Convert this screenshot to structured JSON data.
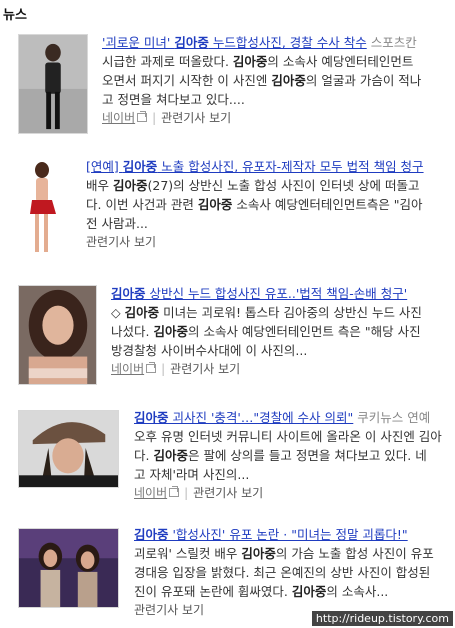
{
  "section": {
    "title": "뉴스"
  },
  "articles": [
    {
      "title_parts": [
        "'괴로운 미녀' ",
        "김아중",
        " 누드합성사진, 경찰 수사 착수"
      ],
      "source": "스포츠칸",
      "desc_lines": [
        [
          "시급한 과제로 떠올랐다. ",
          "김아중",
          "의 소속사 예당엔터테인먼트"
        ],
        [
          "오면서 퍼지기 시작한 이 사진엔 ",
          "김아중",
          "의 얼굴과 가슴이 적나"
        ],
        [
          "고 정면을 쳐다보고 있다....",
          "",
          ""
        ]
      ],
      "naver": "네이버",
      "related": "관련기사 보기"
    },
    {
      "title_parts": [
        "[연예] ",
        "김아중",
        " 노출 합성사진, 유포자-제작자 모두 법적 책임 청구"
      ],
      "source": "",
      "desc_lines": [
        [
          "배우 ",
          "김아중",
          "(27)의 상반신 노출 합성 사진이 인터넷 상에 떠돌고"
        ],
        [
          "다. 이번 사건과 관련 ",
          "김아중",
          " 소속사 예당엔터테인먼트측은 \"김아"
        ],
        [
          "전 사람과...",
          "",
          ""
        ]
      ],
      "naver": "",
      "related": "관련기사 보기"
    },
    {
      "title_parts": [
        "",
        "김아중",
        " 상반신 누드 합성사진 유포..'법적 책임-손배 청구'"
      ],
      "source": "",
      "desc_lines": [
        [
          "◇ ",
          "김아중",
          " 미녀는 괴로워! 톱스타 김아중의 상반신 누드 사진"
        ],
        [
          "나섰다. ",
          "김아중",
          "의 소속사 예당엔터테인먼트 측은 \"해당 사진"
        ],
        [
          "방경찰청 사이버수사대에 이 사진의...",
          "",
          ""
        ]
      ],
      "naver": "네이버",
      "related": "관련기사 보기"
    },
    {
      "title_parts": [
        "",
        "김아중",
        " 괴사진 '충격'…\"경찰에 수사 의뢰\""
      ],
      "source": "쿠키뉴스 연예",
      "desc_lines": [
        [
          "오후 유명 인터넷 커뮤니티 사이트에 올라온 이 사진엔 김아",
          "",
          ""
        ],
        [
          "다. ",
          "김아중",
          "은 팔에 상의를 들고 정면을 쳐다보고 있다. 네"
        ],
        [
          "고 자체'라며 사진의...",
          "",
          ""
        ]
      ],
      "naver": "네이버",
      "related": "관련기사 보기"
    },
    {
      "title_parts": [
        "",
        "김아중",
        " '합성사진' 유포 논란 · \"미녀는 정말 괴롭다!\""
      ],
      "source": "",
      "desc_lines": [
        [
          "괴로워' 스릴컷 배우 ",
          "김아중",
          "의 가슴 노출 합성 사진이 유포"
        ],
        [
          "경대응 입장을 밝혔다. 최근 온예진의 상반 사진이 합성된"
        ],
        [
          "진이 유포돼 논란에 휩싸였다. ",
          "김아중",
          "의 소속사..."
        ]
      ],
      "naver": "",
      "related": "관련기사 보기"
    }
  ],
  "watermark": "http://rideup.tistory.com"
}
